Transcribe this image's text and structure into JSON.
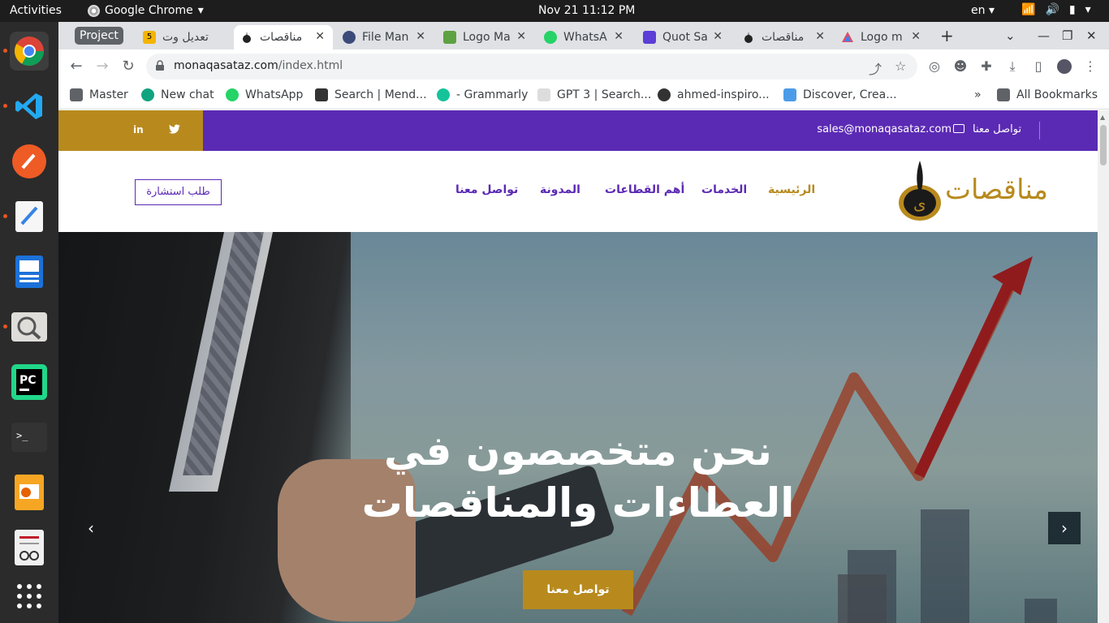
{
  "system": {
    "activities": "Activities",
    "app_name": "Google Chrome",
    "clock": "Nov 21  11:12 PM",
    "lang": "en"
  },
  "tabs": {
    "group_label": "Project",
    "items": [
      {
        "label": "تعديل وت",
        "color": "#f4b400",
        "badge": "5"
      },
      {
        "label": "مناقصات",
        "color": "#ffffff"
      },
      {
        "label": "File Man",
        "color": "#3c4a7a"
      },
      {
        "label": "Logo Ma",
        "color": "#5ea142"
      },
      {
        "label": "WhatsA",
        "color": "#25d366"
      },
      {
        "label": "Quot Sa",
        "color": "#5b3fd6"
      },
      {
        "label": "مناقصات",
        "color": "#ffffff"
      },
      {
        "label": "Logo m",
        "color": "#e84a5f"
      }
    ],
    "new_tab": "+"
  },
  "toolbar": {
    "url_host": "monaqasataz.com",
    "url_path": "/index.html"
  },
  "bookmarks": {
    "items": [
      {
        "label": "Master",
        "color": "#5f6368"
      },
      {
        "label": "New chat",
        "color": "#10a37f"
      },
      {
        "label": "WhatsApp",
        "color": "#25d366"
      },
      {
        "label": "Search | Mend...",
        "color": "#333333"
      },
      {
        "label": "- Grammarly",
        "color": "#15c39a"
      },
      {
        "label": "GPT 3 | Search...",
        "color": "#888888"
      },
      {
        "label": "ahmed-inspiro...",
        "color": "#333333"
      },
      {
        "label": "Discover, Crea...",
        "color": "#4c9be8"
      }
    ],
    "more": "»",
    "all_bookmarks": "All Bookmarks"
  },
  "site": {
    "email": "sales@monaqasataz.com",
    "contact_label": "تواصل معنا",
    "social_linkedin": "in",
    "social_twitter": "🐦",
    "logo_text": "مناقصات",
    "menu": [
      {
        "label": "الرئيسية",
        "active": true
      },
      {
        "label": "الخدمات"
      },
      {
        "label": "أهم القطاعات"
      },
      {
        "label": "المدونة"
      },
      {
        "label": "تواصل معنا"
      }
    ],
    "consult_button": "طلب استشارة",
    "hero_title_line1": "نحن متخصصون في",
    "hero_title_line2": "العطاءات والمناقصات",
    "hero_cta": "تواصل معنا",
    "colors": {
      "purple": "#5b2ab4",
      "gold": "#b88a1e"
    }
  }
}
